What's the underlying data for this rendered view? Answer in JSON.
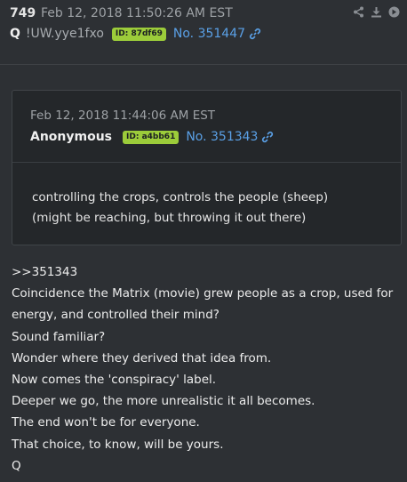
{
  "post": {
    "number": "749",
    "date": "Feb 12, 2018 11:50:26 AM EST",
    "author": "Q",
    "tripcode": "!UW.yye1fxo",
    "id_badge": "ID: 87df69",
    "post_link": "No. 351447",
    "icons": [
      "share-icon",
      "download-icon",
      "arrow-right-icon"
    ]
  },
  "quoted": {
    "date": "Feb 12, 2018 11:44:06 AM EST",
    "author": "Anonymous",
    "id_badge": "ID: a4bb61",
    "post_link": "No. 351343",
    "lines": [
      "controlling the crops, controls the people (sheep)",
      "(might be reaching, but throwing it out there)"
    ]
  },
  "body": {
    "lines": [
      ">>351343",
      "Coincidence the Matrix (movie) grew people as a crop, used for",
      "energy, and controlled their mind?",
      "Sound familiar?",
      "Wonder where they derived that idea from.",
      "Now comes the 'conspiracy' label.",
      "Deeper we go, the more unrealistic it all becomes.",
      "The end won't be for everyone.",
      "That choice, to know, will be yours.",
      "Q"
    ]
  },
  "colors": {
    "background": "#2d3034",
    "quote_background": "#24272a",
    "badge": "#9ccc3a",
    "link": "#5aa0e6"
  }
}
